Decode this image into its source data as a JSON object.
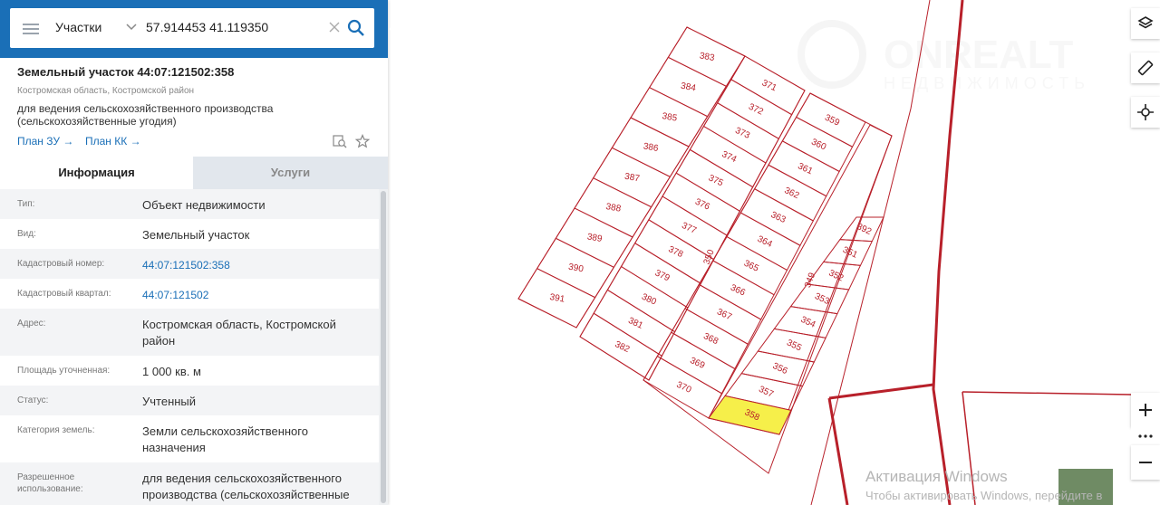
{
  "search": {
    "type_label": "Участки",
    "query": "57.914453 41.119350"
  },
  "object": {
    "title": "Земельный участок 44:07:121502:358",
    "region": "Костромская область, Костромской район",
    "purpose": "для ведения сельскохозяйственного производства (сельскохозяйственные угодия)",
    "plan_zu": "План ЗУ →",
    "plan_kk": "План КК →"
  },
  "tabs": {
    "info": "Информация",
    "services": "Услуги"
  },
  "info_rows": [
    {
      "label": "Тип:",
      "value": "Объект недвижимости"
    },
    {
      "label": "Вид:",
      "value": "Земельный участок"
    },
    {
      "label": "Кадастровый номер:",
      "value": "44:07:121502:358"
    },
    {
      "label": "Кадастровый квартал:",
      "value": "44:07:121502"
    },
    {
      "label": "Адрес:",
      "value": "Костромская область, Костромской район"
    },
    {
      "label": "Площадь уточненная:",
      "value": "1 000 кв. м"
    },
    {
      "label": "Статус:",
      "value": "Учтенный"
    },
    {
      "label": "Категория земель:",
      "value": "Земли сельскохозяйственного назначения"
    },
    {
      "label": "Разрешенное использование:",
      "value": "для ведения сельскохозяйственного производства (сельскохозяйственные"
    }
  ],
  "map": {
    "parcel_color": "#b8202a",
    "selected_fill": "#f6ef4a",
    "watermark": "ONREALT",
    "watermark_sub": "НЕДВИЖИМОСТЬ",
    "lots": {
      "col1": [
        "383",
        "384",
        "385",
        "386",
        "387",
        "388",
        "389",
        "390",
        "391"
      ],
      "col2": [
        "371",
        "372",
        "373",
        "374",
        "375",
        "376",
        "377",
        "378",
        "379",
        "380",
        "381",
        "382"
      ],
      "col3": [
        "359",
        "360",
        "361",
        "362",
        "363",
        "364",
        "365",
        "366",
        "367",
        "368",
        "369",
        "370"
      ],
      "col4": [
        "349",
        "392",
        "351",
        "352",
        "353",
        "354",
        "355",
        "356",
        "357",
        "358"
      ],
      "strip": "350",
      "col3_alt": "369",
      "col4_alt": "355"
    },
    "selected_lot": "358"
  },
  "windows_activation": {
    "line1": "Активация Windows",
    "line2": "Чтобы активировать Windows, перейдите в"
  }
}
